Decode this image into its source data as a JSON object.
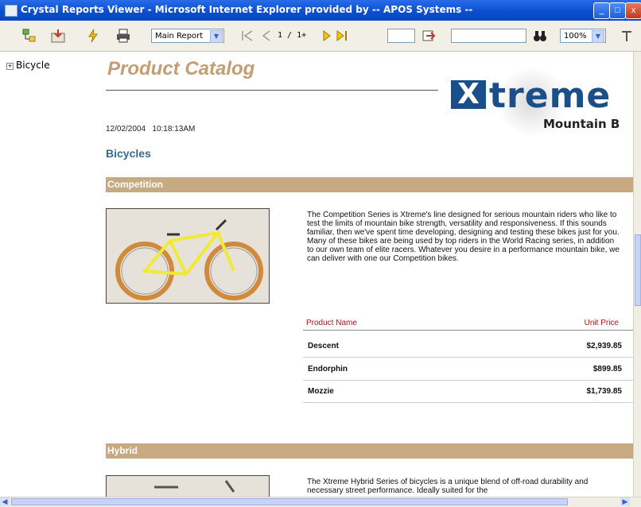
{
  "window": {
    "title": "Crystal Reports Viewer - Microsoft Internet Explorer provided by -- APOS Systems --",
    "minimize_glyph": "_",
    "maximize_glyph": "□",
    "close_glyph": "x"
  },
  "toolbar": {
    "report_selector": "Main Report",
    "page_indicator": "1 / 1+",
    "zoom": "100%"
  },
  "tree": {
    "items": [
      {
        "label": "Bicycle"
      }
    ]
  },
  "report": {
    "title": "Product Catalog",
    "date": "12/02/2004",
    "time": "10:18:13AM",
    "logo_word": "treme",
    "logo_x": "X",
    "logo_subtitle": "Mountain B",
    "group_header": "Bicycles",
    "sections": [
      {
        "name": "Competition",
        "description": "The Competition Series is Xtreme's line designed for serious mountain riders who like to test the limits of mountain bike strength, versatility and responsiveness.  If this sounds familiar, then we've spent time developing, designing and testing these bikes just for you.  Many of these bikes are being used by top riders in the World Racing series, in addition to our own team of elite racers.  Whatever you desire in a performance mountain bike, we can deliver with one our Competition bikes."
      },
      {
        "name": "Hybrid",
        "description": "The Xtreme Hybrid Series of bicycles is a unique blend of off-road durability and necessary street performance.  Ideally suited for the"
      }
    ],
    "table": {
      "col_name": "Product Name",
      "col_price": "Unit Price",
      "rows": [
        {
          "name": "Descent",
          "price": "$2,939.85"
        },
        {
          "name": "Endorphin",
          "price": "$899.85"
        },
        {
          "name": "Mozzie",
          "price": "$1,739.85"
        }
      ]
    }
  },
  "colors": {
    "title_tan": "#c29e72",
    "band_tan": "#c8aa82",
    "header_red": "#a5161d",
    "group_teal": "#3a6b8a",
    "titlebar_blue": "#0a4fd0",
    "logo_blue": "#1b4f8a"
  }
}
